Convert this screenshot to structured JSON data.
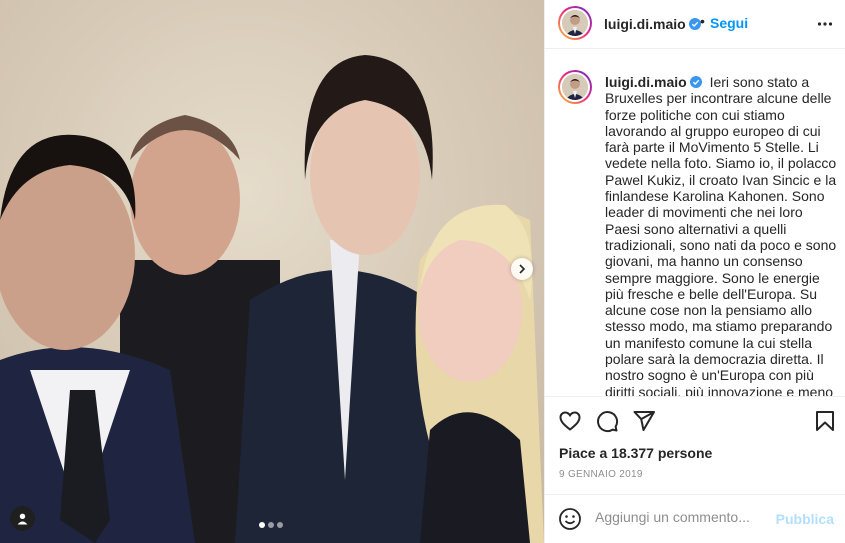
{
  "post": {
    "username": "luigi.di.maio",
    "follow_label": "Segui",
    "separator": "•",
    "caption": "Ieri sono stato a Bruxelles per incontrare alcune delle forze politiche con cui stiamo lavorando al gruppo europeo di cui farà parte il MoVimento 5 Stelle. Li vedete nella foto. Siamo io, il polacco Pawel Kukiz, il croato Ivan Sincic e la finlandese Karolina Kahonen. Sono leader di movimenti che nei loro Paesi sono alternativi a quelli tradizionali, sono nati da poco e sono giovani, ma hanno un consenso sempre maggiore. Sono le energie più fresche e belle dell'Europa. Su alcune cose non la pensiamo allo stesso modo, ma stiamo preparando un manifesto comune la cui stella polare sarà la democrazia diretta. Il nostro sogno è un'Europa con più diritti sociali, più innovazione e meno vincoli ai bilanci. L'Europa deve smettere di",
    "likes": "Piace a 18.377 persone",
    "date": "9 GENNAIO 2019"
  },
  "comment": {
    "placeholder": "Aggiungi un commento...",
    "publish_label": "Pubblica"
  },
  "carousel": {
    "total": 3,
    "current": 1
  },
  "icons": {
    "verified": "verified-badge-icon",
    "more": "more-options-icon",
    "like": "heart-icon",
    "comment": "comment-icon",
    "share": "paper-plane-icon",
    "save": "bookmark-icon",
    "emoji": "emoji-icon",
    "next": "chevron-right-icon",
    "tags": "user-tag-icon"
  },
  "colors": {
    "accent": "#0095f6",
    "publish_disabled": "#b2dffc",
    "verified": "#3897f0",
    "muted": "#8e8e8e"
  }
}
